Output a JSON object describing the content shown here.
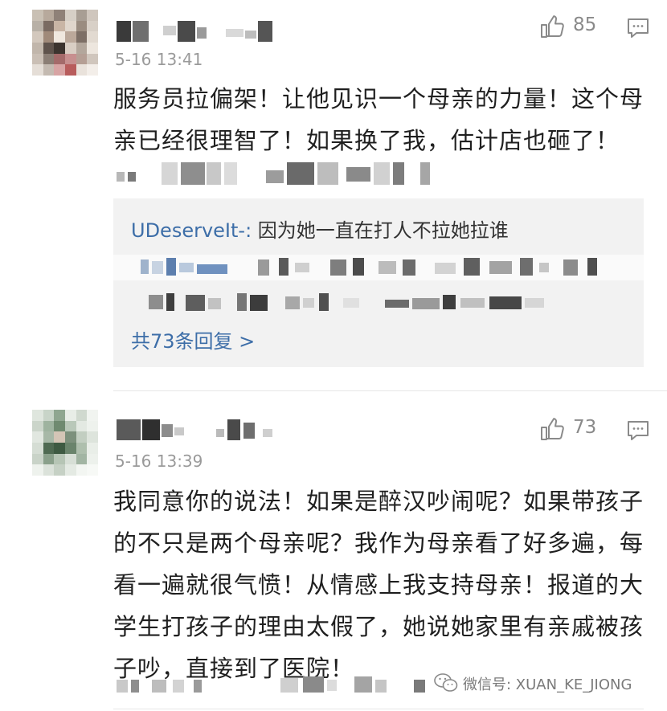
{
  "comments": [
    {
      "time": "5-16 13:41",
      "likes": "85",
      "text_lines": [
        "服务员拉偏架！让他见识一个母亲的力量！这个母",
        "亲已经很理智了！如果换了我，估计店也砸了！"
      ],
      "reply": {
        "user": "UDeserveIt-:",
        "text": " 因为她一直在打人不拉她拉谁",
        "more_label": "共73条回复 >"
      }
    },
    {
      "time": "5-16 13:39",
      "likes": "73",
      "text_lines": [
        "我同意你的说法！如果是醉汉吵闹呢？如果带孩子",
        "的不只是两个母亲呢？我作为母亲看了好多遍，每",
        "看一遍就很气愤！从情感上我支持母亲！报道的大",
        "学生打孩子的理由太假了，她说她家里有亲戚被孩",
        "子吵，直接到了医院！"
      ]
    }
  ],
  "icons": {
    "like": "thumbs-up-icon",
    "reply": "comment-icon",
    "wechat": "wechat-icon"
  },
  "colors": {
    "link": "#3d6ea8",
    "reply_bg": "#f2f2f2",
    "muted": "#9a9a9a"
  },
  "watermark": "微信号: XUAN_KE_JIONG"
}
